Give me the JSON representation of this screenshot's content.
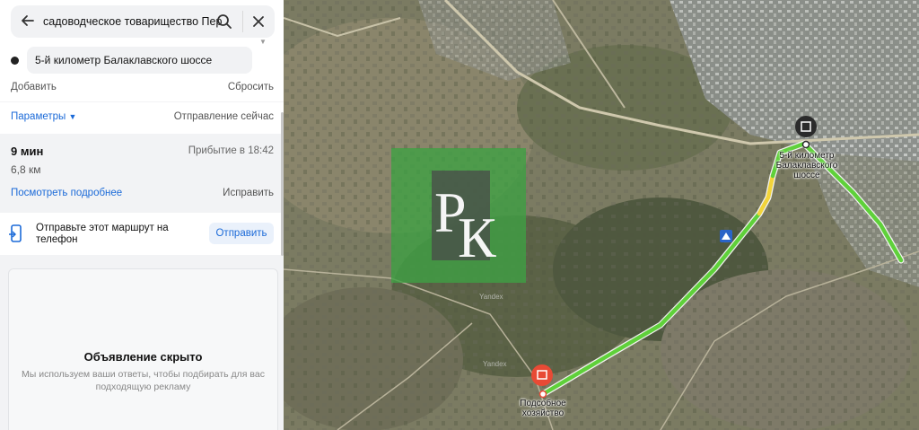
{
  "search": {
    "query": "садоводческое товарищество Перис",
    "destination": "5-й километр Балаклавского шоссе",
    "add_label": "Добавить",
    "reset_label": "Сбросить"
  },
  "params": {
    "label": "Параметры",
    "departure": "Отправление сейчас"
  },
  "route": {
    "time": "9 мин",
    "arrival": "Прибытие в 18:42",
    "distance": "6,8 км",
    "details_link": "Посмотреть подробнее",
    "edit_label": "Исправить"
  },
  "send": {
    "text": "Отправьте этот маршрут на телефон",
    "button": "Отправить"
  },
  "ad": {
    "title": "Объявление скрыто",
    "subtitle": "Мы используем ваши ответы, чтобы подбирать для вас подходящую рекламу"
  },
  "map": {
    "end_label": "5-й километр Балаклавского шоссе",
    "start_label": "Подсобное хозяйство",
    "watermark_letters": "РК",
    "yandex_marks": [
      "Yandex",
      "Yandex"
    ]
  },
  "colors": {
    "accent": "#1b6ad8",
    "route_green": "#5fd13a",
    "route_yellow": "#f2d43a",
    "start_pin": "#e84a35",
    "end_pin": "#2b2b2b",
    "watermark": "#3fa044"
  },
  "icons": [
    "back-arrow-icon",
    "search-icon",
    "close-icon",
    "phone-icon",
    "triangle-sign-icon",
    "building-pin-icon"
  ]
}
